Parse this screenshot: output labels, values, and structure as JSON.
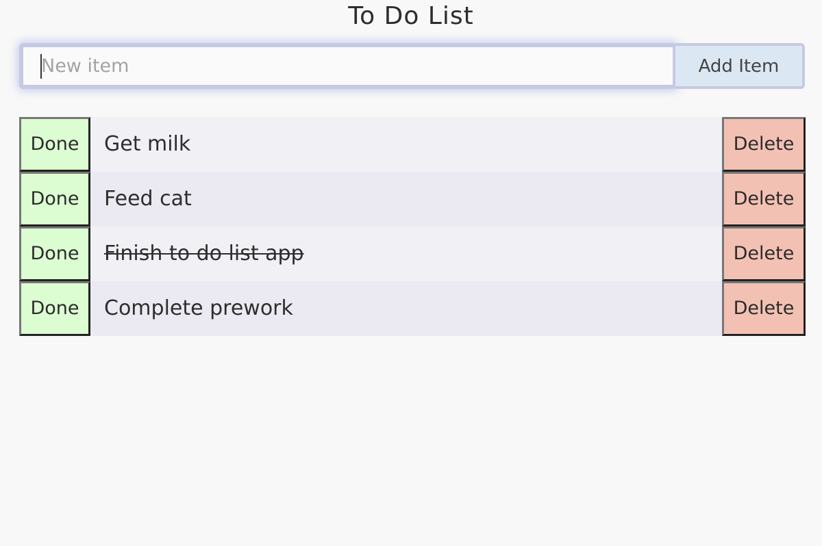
{
  "header": {
    "title": "To Do List"
  },
  "add_bar": {
    "input_placeholder": "New item",
    "input_value": "",
    "add_button_label": "Add Item"
  },
  "todo": {
    "done_label": "Done",
    "delete_label": "Delete",
    "items": [
      {
        "text": "Get milk",
        "completed": false
      },
      {
        "text": "Feed cat",
        "completed": false
      },
      {
        "text": "Finish to do list app",
        "completed": true
      },
      {
        "text": "Complete prework",
        "completed": false
      }
    ]
  },
  "colors": {
    "page_background": "#f8f8f8",
    "done_button": "#dcfdd2",
    "delete_button": "#f3c1b3",
    "add_button": "#dce7f4",
    "input_border": "#c7c8e2",
    "row_light": "#f1f0f5",
    "row_dark": "#ebe9f1"
  }
}
